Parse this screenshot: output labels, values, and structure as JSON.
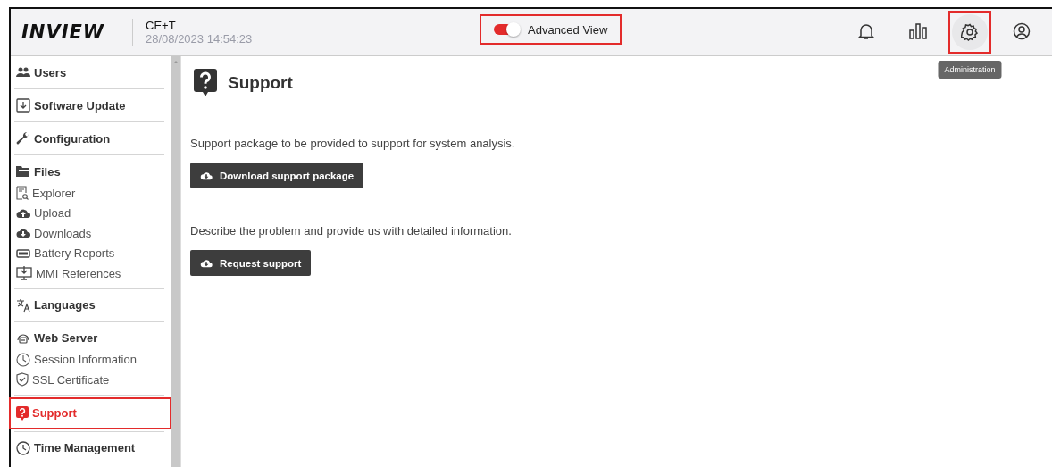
{
  "header": {
    "logo": "INVIEW",
    "device": "CE+T",
    "datetime": "28/08/2023 14:54:23",
    "toggle": {
      "label": "Advanced View",
      "on": true,
      "highlighted": true
    },
    "icons": [
      {
        "highlighted": false
      },
      {
        "highlighted": false
      },
      {
        "highlighted": true,
        "tooltip": "Administration"
      },
      {
        "highlighted": false
      }
    ]
  },
  "sidebar": {
    "groups": [
      {
        "title": "Users",
        "selected": false,
        "highlighted": false
      },
      {
        "title": "Software Update",
        "selected": false,
        "highlighted": false
      },
      {
        "title": "Configuration",
        "selected": false,
        "highlighted": false
      },
      {
        "title": "Files",
        "selected": false,
        "highlighted": false,
        "items": [
          "Explorer",
          "Upload",
          "Downloads",
          "Battery Reports",
          "MMI References"
        ]
      },
      {
        "title": "Languages",
        "selected": false,
        "highlighted": false
      },
      {
        "title": "Web Server",
        "selected": false,
        "highlighted": false,
        "items": [
          "Session Information",
          "SSL Certificate"
        ]
      },
      {
        "title": "Support",
        "selected": true,
        "highlighted": true
      },
      {
        "title": "Time Management",
        "selected": false,
        "highlighted": false
      }
    ]
  },
  "main": {
    "title": "Support",
    "sections": [
      {
        "text": "Support package to be provided to support for system analysis.",
        "button": "Download support package"
      },
      {
        "text": "Describe the problem and provide us with detailed information.",
        "button": "Request support"
      }
    ]
  }
}
